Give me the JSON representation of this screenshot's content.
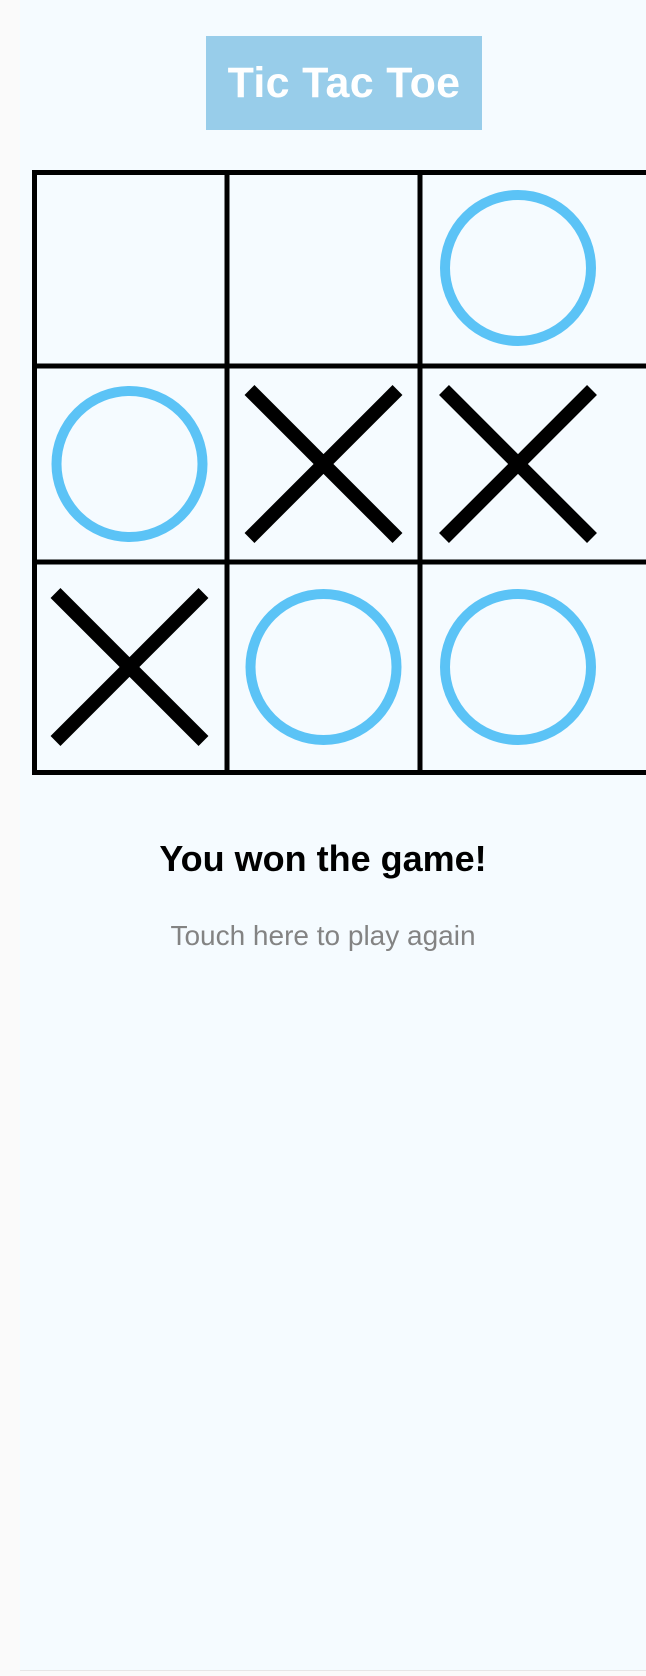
{
  "header": {
    "title": "Tic Tac Toe"
  },
  "board": {
    "cells": [
      "",
      "",
      "O",
      "O",
      "X",
      "X",
      "X",
      "O",
      "O"
    ]
  },
  "status": {
    "message": "You won the game!",
    "replay_label": "Touch here to play again"
  },
  "colors": {
    "o_mark": "#5bc3f6",
    "x_mark": "#000000",
    "grid": "#000000",
    "title_bg": "#98cdea"
  }
}
